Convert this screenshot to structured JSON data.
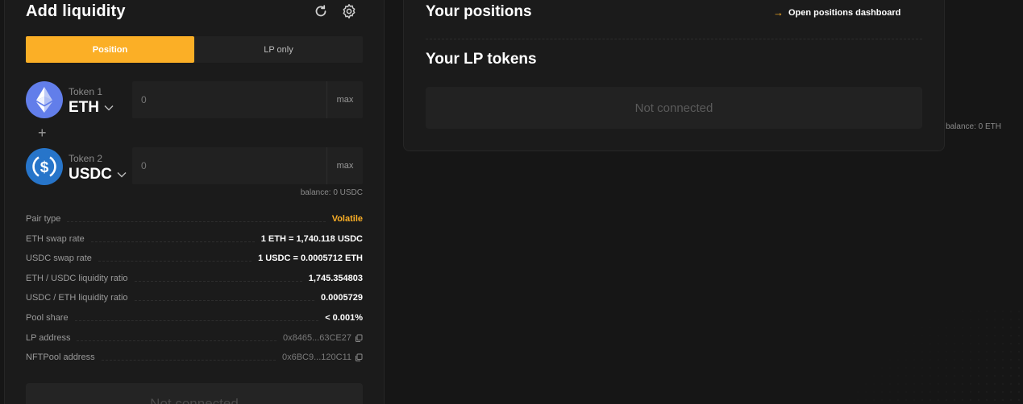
{
  "add_liquidity": {
    "title": "Add liquidity",
    "tabs": [
      {
        "label": "Position",
        "active": true
      },
      {
        "label": "LP only",
        "active": false
      }
    ],
    "token1": {
      "caption": "Token 1",
      "symbol": "ETH",
      "amount_placeholder": "0",
      "max_label": "max",
      "balance": "balance: 0 ETH",
      "icon": "eth-icon"
    },
    "token2": {
      "caption": "Token 2",
      "symbol": "USDC",
      "amount_placeholder": "0",
      "max_label": "max",
      "balance": "balance: 0 USDC",
      "icon": "usdc-icon"
    },
    "plus": "+",
    "details": [
      {
        "label": "Pair type",
        "value": "Volatile"
      },
      {
        "label": "ETH swap rate",
        "value": "1 ETH = 1,740.118 USDC"
      },
      {
        "label": "USDC swap rate",
        "value": "1 USDC = 0.0005712 ETH"
      },
      {
        "label": "ETH / USDC liquidity ratio",
        "value": "1,745.354803"
      },
      {
        "label": "USDC / ETH liquidity ratio",
        "value": "0.0005729"
      },
      {
        "label": "Pool share",
        "value": "< 0.001%"
      },
      {
        "label": "LP address",
        "value": "0x8465...63CE27"
      },
      {
        "label": "NFTPool address",
        "value": "0x6BC9...120C11"
      }
    ],
    "submit_label": "Not connected"
  },
  "positions": {
    "title": "Your positions",
    "dashboard_link": "Open positions dashboard",
    "lp_title": "Your LP tokens",
    "lp_status": "Not connected"
  },
  "colors": {
    "accent": "#fbaf26",
    "background": "#161616",
    "panel": "#1b1b1b"
  }
}
